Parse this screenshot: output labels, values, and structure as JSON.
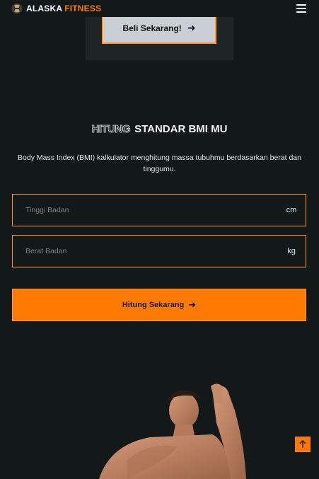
{
  "header": {
    "brand_part1": "ALASKA",
    "brand_part2": "FITNESS",
    "logo_icon": "dumbbell-logo-icon",
    "menu_icon": "hamburger-menu-icon"
  },
  "promo": {
    "buy_label": "Beli Sekarang!",
    "buy_icon": "arrow-right-icon"
  },
  "bmi": {
    "title_outline": "Hitung",
    "title_solid": "Standar BMI MU",
    "description": "Body Mass Index (BMI) kalkulator menghitung massa tubuhmu berdasarkan berat dan tinggumu.",
    "height_placeholder": "Tinggi Badan",
    "height_unit": "cm",
    "weight_placeholder": "Berat Badan",
    "weight_unit": "kg",
    "submit_label": "Hitung Sekarang",
    "submit_icon": "arrow-right-icon"
  },
  "scroll_top_icon": "arrow-up-icon",
  "colors": {
    "background": "#131818",
    "accent": "#ff7a00",
    "accent_border": "#ff9a2a",
    "card": "#1f2424"
  }
}
